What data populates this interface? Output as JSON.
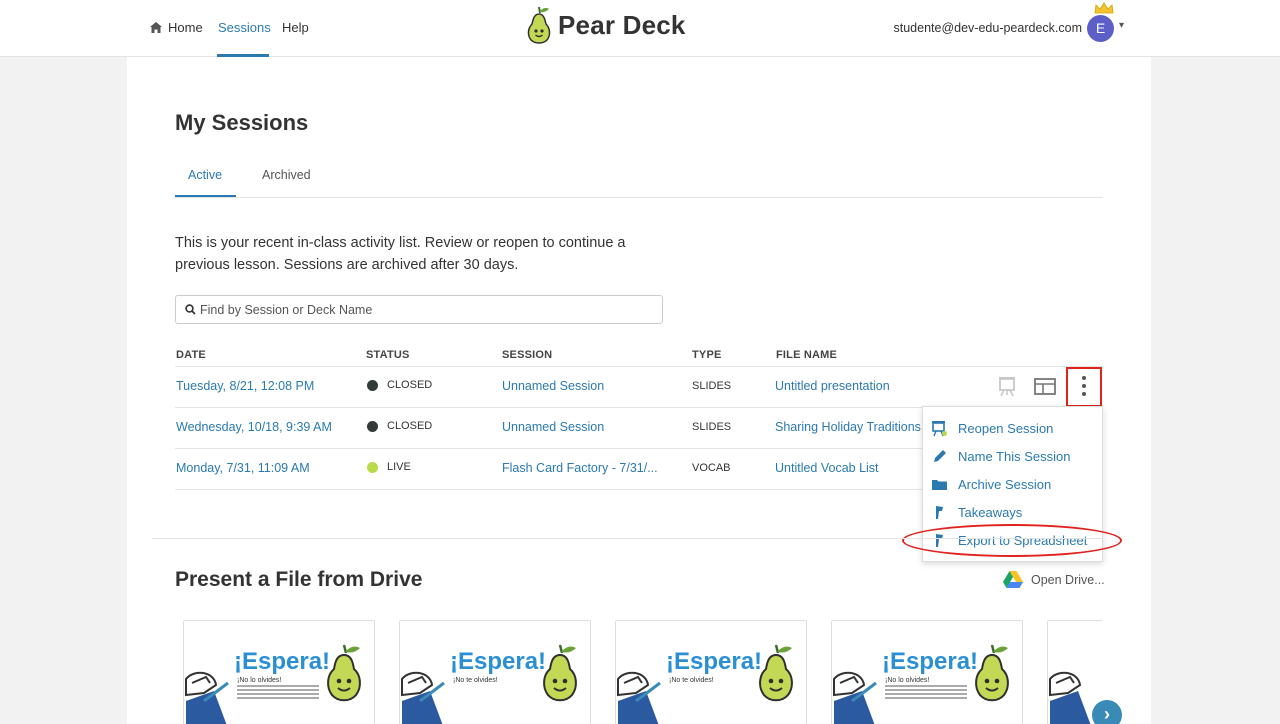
{
  "nav": {
    "home_label": "Home",
    "sessions_label": "Sessions",
    "help_label": "Help",
    "logo_text": "Pear Deck",
    "user_email": "studente@dev-edu-peardeck.com",
    "avatar_initial": "E"
  },
  "page": {
    "title": "My Sessions",
    "tabs": [
      {
        "label": "Active",
        "selected": true
      },
      {
        "label": "Archived",
        "selected": false
      }
    ],
    "intro_text": "This is your recent in-class activity list. Review or reopen to continue a previous lesson. Sessions are archived after 30 days.",
    "search_placeholder": "Find by Session or Deck Name"
  },
  "table": {
    "columns": [
      "DATE",
      "STATUS",
      "SESSION",
      "TYPE",
      "FILE NAME"
    ],
    "rows": [
      {
        "date": "Tuesday, 8/21, 12:08 PM",
        "status": "CLOSED",
        "status_color": "#333b3a",
        "session": "Unnamed Session",
        "type": "SLIDES",
        "file_name": "Untitled presentation"
      },
      {
        "date": "Wednesday, 10/18, 9:39 AM",
        "status": "CLOSED",
        "status_color": "#333b3a",
        "session": "Unnamed Session",
        "type": "SLIDES",
        "file_name": "Sharing Holiday Traditions"
      },
      {
        "date": "Monday, 7/31, 11:09 AM",
        "status": "LIVE",
        "status_color": "#bcd94a",
        "session": "Flash Card Factory - 7/31/...",
        "type": "VOCAB",
        "file_name": "Untitled Vocab List"
      }
    ]
  },
  "menu": {
    "items": [
      {
        "label": "Reopen Session",
        "icon": "presentation-icon"
      },
      {
        "label": "Name This Session",
        "icon": "pencil-icon"
      },
      {
        "label": "Archive Session",
        "icon": "folder-icon"
      },
      {
        "label": "Takeaways",
        "icon": "takeaways-icon"
      },
      {
        "label": "Export to Spreadsheet",
        "icon": "export-icon"
      }
    ]
  },
  "drive": {
    "title": "Present a File from Drive",
    "open_label": "Open Drive...",
    "thumbnails": [
      {
        "heading": "¡Espera!",
        "subheading": "¡No lo olvides!"
      },
      {
        "heading": "¡Espera!",
        "subheading": "¡No te olvides!"
      },
      {
        "heading": "¡Espera!",
        "subheading": "¡No te olvides!"
      },
      {
        "heading": "¡Espera!",
        "subheading": "¡No lo olvides!"
      }
    ]
  },
  "colors": {
    "accent": "#2a7ab0",
    "highlight": "#e0231f",
    "live": "#bcd94a",
    "closed": "#333b3a"
  }
}
